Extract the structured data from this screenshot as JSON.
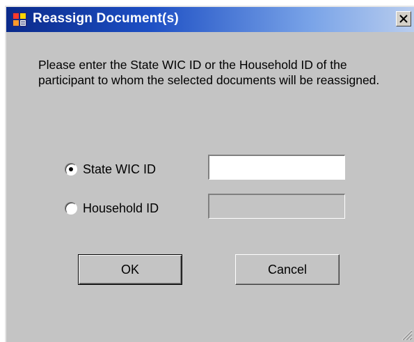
{
  "window": {
    "title": "Reassign Document(s)",
    "icon": "app-window-icon",
    "close_icon": "close-icon"
  },
  "instructions": "Please enter the State WIC ID or the Household ID of the participant to whom the selected documents will be reassigned.",
  "options": [
    {
      "label": "State WIC ID",
      "selected": true,
      "input_value": "",
      "input_enabled": true
    },
    {
      "label": "Household ID",
      "selected": false,
      "input_value": "",
      "input_enabled": false
    }
  ],
  "buttons": {
    "ok": "OK",
    "cancel": "Cancel"
  },
  "colors": {
    "title_gradient_start": "#0a2a8a",
    "title_gradient_end": "#b9cdee",
    "dialog_face": "#c4c4c4"
  }
}
